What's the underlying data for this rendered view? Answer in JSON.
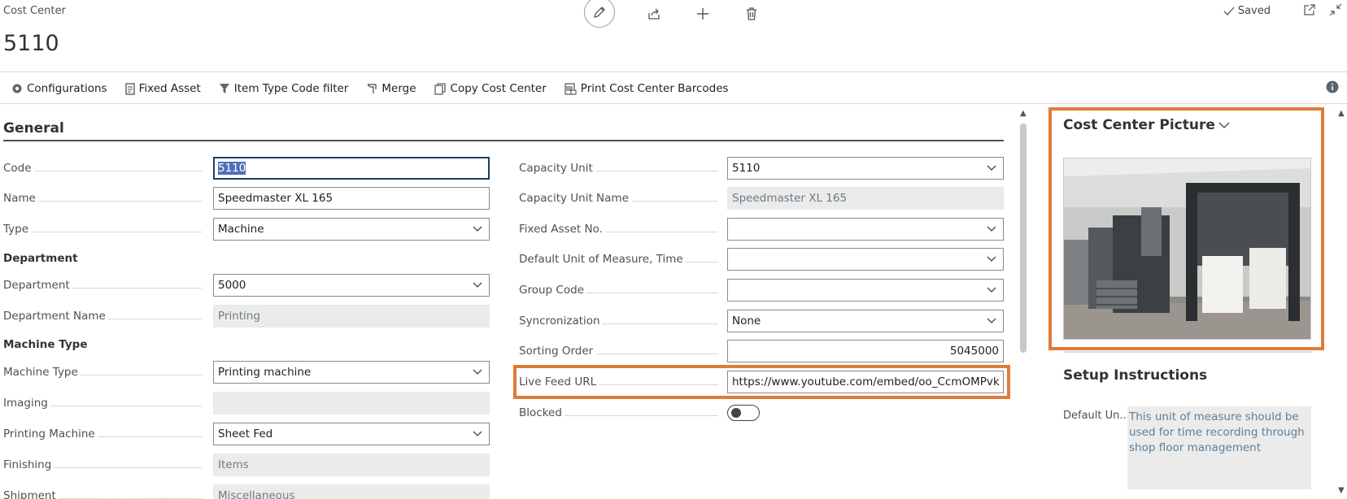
{
  "header": {
    "caption": "Cost Center",
    "title": "5110",
    "saved_label": "Saved"
  },
  "actions": {
    "configurations": "Configurations",
    "fixed_asset": "Fixed Asset",
    "item_type_code_filter": "Item Type Code filter",
    "merge": "Merge",
    "copy_cost_center": "Copy Cost Center",
    "print_barcodes": "Print Cost Center Barcodes"
  },
  "general": {
    "title": "General",
    "code": {
      "label": "Code",
      "value": "5110"
    },
    "name": {
      "label": "Name",
      "value": "Speedmaster XL 165"
    },
    "type": {
      "label": "Type",
      "value": "Machine"
    },
    "department_head": "Department",
    "department": {
      "label": "Department",
      "value": "5000"
    },
    "department_name": {
      "label": "Department Name",
      "value": "Printing"
    },
    "machine_type_head": "Machine Type",
    "machine_type": {
      "label": "Machine Type",
      "value": "Printing machine"
    },
    "imaging": {
      "label": "Imaging",
      "value": ""
    },
    "printing_machine": {
      "label": "Printing Machine",
      "value": "Sheet Fed"
    },
    "finishing": {
      "label": "Finishing",
      "value": "Items"
    },
    "shipment": {
      "label": "Shipment",
      "value": "Miscellaneous"
    },
    "capacity_unit": {
      "label": "Capacity Unit",
      "value": "5110"
    },
    "capacity_unit_name": {
      "label": "Capacity Unit Name",
      "value": "Speedmaster XL 165"
    },
    "fixed_asset_no": {
      "label": "Fixed Asset No.",
      "value": ""
    },
    "default_uom_time": {
      "label": "Default Unit of Measure, Time",
      "value": ""
    },
    "group_code": {
      "label": "Group Code",
      "value": ""
    },
    "syncronization": {
      "label": "Syncronization",
      "value": "None"
    },
    "sorting_order": {
      "label": "Sorting Order",
      "value": "5045000"
    },
    "live_feed_url": {
      "label": "Live Feed URL",
      "value": "https://www.youtube.com/embed/oo_CcmOMPvk"
    },
    "blocked": {
      "label": "Blocked",
      "value": false
    }
  },
  "factbox": {
    "picture_title": "Cost Center Picture",
    "setup_title": "Setup Instructions",
    "setup_label": "Default Un...",
    "setup_text": "This unit of measure should be used for time recording through shop floor management"
  },
  "colors": {
    "highlight": "#e07b39",
    "focus_border": "#1f3c63",
    "readonly_bg": "#ebebeb"
  }
}
